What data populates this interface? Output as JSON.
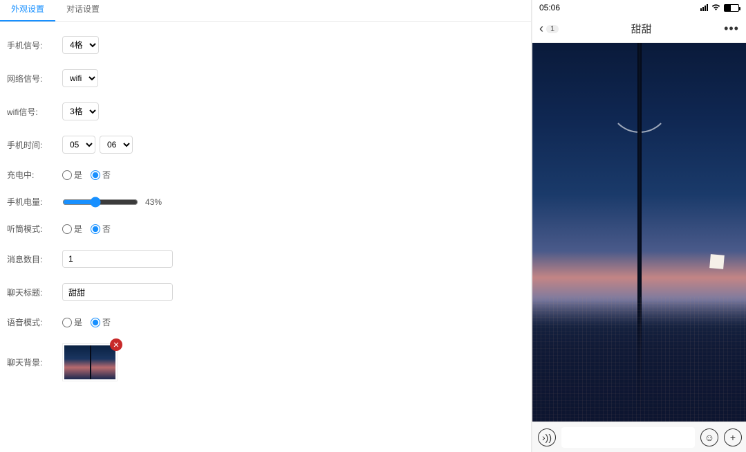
{
  "tabs": {
    "appearance": "外观设置",
    "dialog": "对话设置"
  },
  "form": {
    "phone_signal": {
      "label": "手机信号:",
      "value": "4格"
    },
    "network_signal": {
      "label": "网络信号:",
      "value": "wifi"
    },
    "wifi_signal": {
      "label": "wifi信号:",
      "value": "3格"
    },
    "phone_time": {
      "label": "手机时间:",
      "hour": "05",
      "minute": "06"
    },
    "charging": {
      "label": "充电中:",
      "yes": "是",
      "no": "否",
      "value": "no"
    },
    "battery": {
      "label": "手机电量:",
      "value": 43,
      "display": "43%"
    },
    "earpiece": {
      "label": "听筒模式:",
      "yes": "是",
      "no": "否",
      "value": "no"
    },
    "message_count": {
      "label": "消息数目:",
      "value": "1"
    },
    "chat_title": {
      "label": "聊天标题:",
      "value": "甜甜"
    },
    "voice_mode": {
      "label": "语音模式:",
      "yes": "是",
      "no": "否",
      "value": "no"
    },
    "chat_bg": {
      "label": "聊天背景:",
      "remove_icon": "✕"
    }
  },
  "preview": {
    "statusbar_time": "05:06",
    "nav_badge": "1",
    "nav_title": "甜甜",
    "nav_more": "•••",
    "voice_glyph": "›))",
    "emoji_glyph": "☺",
    "plus_glyph": "+"
  }
}
